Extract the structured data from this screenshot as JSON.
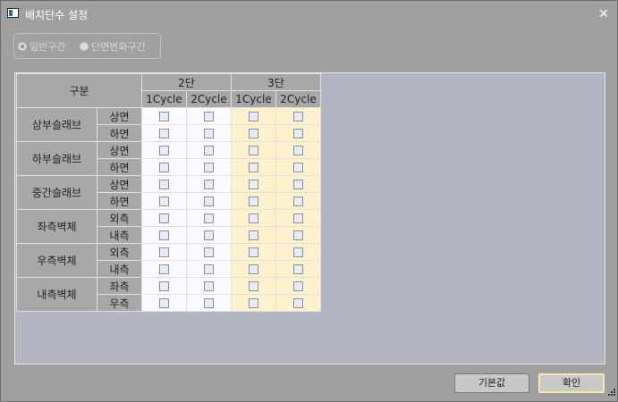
{
  "window": {
    "title": "배치단수 설정",
    "close_glyph": "✕"
  },
  "radio": {
    "options": [
      {
        "label": "일반구간",
        "checked": true
      },
      {
        "label": "단면변화구간",
        "checked": false
      }
    ]
  },
  "grid": {
    "corner_label": "구분",
    "groups": [
      {
        "label": "2단",
        "columns": [
          "1Cycle",
          "2Cycle"
        ]
      },
      {
        "label": "3단",
        "columns": [
          "1Cycle",
          "2Cycle"
        ]
      }
    ],
    "row_groups": [
      {
        "label": "상부슬래브",
        "subs": [
          "상면",
          "하면"
        ]
      },
      {
        "label": "하부슬래브",
        "subs": [
          "상면",
          "하면"
        ]
      },
      {
        "label": "중간슬래브",
        "subs": [
          "상면",
          "하면"
        ]
      },
      {
        "label": "좌측벽체",
        "subs": [
          "외측",
          "내측"
        ]
      },
      {
        "label": "우측벽체",
        "subs": [
          "외측",
          "내측"
        ]
      },
      {
        "label": "내측벽체",
        "subs": [
          "좌측",
          "우측"
        ]
      }
    ]
  },
  "buttons": {
    "default_label": "기본값",
    "ok_label": "확인"
  },
  "colors": {
    "col_2dan_bg": "#fdfbff",
    "col_3dan_bg": "#fdf2cc",
    "header_bg": "#a8a8a8",
    "grid_bg": "#b2b6c2"
  }
}
